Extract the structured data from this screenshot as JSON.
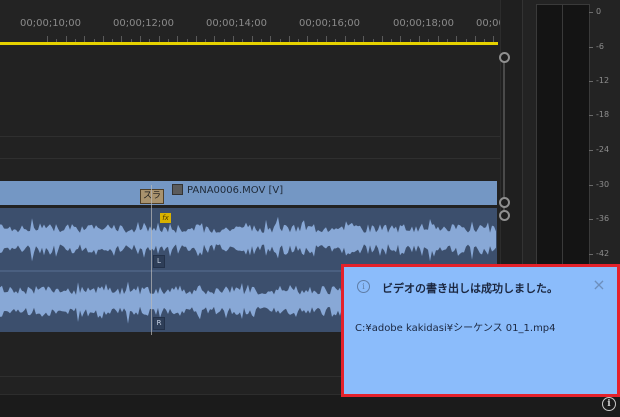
{
  "ruler": {
    "timecodes": [
      "00;00;10;00",
      "00;00;12;00",
      "00;00;14;00",
      "00;00;16;00",
      "00;00;18;00",
      "00;00;2"
    ]
  },
  "video_track": {
    "clip_name": "PANA0006.MOV [V]",
    "label_chip": "スラ",
    "fx_badge": "fx"
  },
  "audio_track": {
    "fx_badge": "fx",
    "channel_left": "L",
    "channel_right": "R"
  },
  "meter": {
    "db_labels": [
      "0",
      "-6",
      "-12",
      "-18",
      "-24",
      "-30",
      "-36",
      "-42"
    ]
  },
  "notification": {
    "title": "ビデオの書き出しは成功しました。",
    "message": "C:¥adobe kakidasi¥シーケンス 01_1.mp4",
    "info_icon": "info-icon",
    "close_icon": "×"
  },
  "status_bar": {
    "info_icon": "i"
  },
  "colors": {
    "work_area": "#e6d200",
    "video_clip": "#7497c4",
    "audio_clip": "#3c4f6d",
    "waveform": "#88a8d6",
    "notification_bg": "#8bbcfb",
    "notification_border": "#e4212b"
  }
}
